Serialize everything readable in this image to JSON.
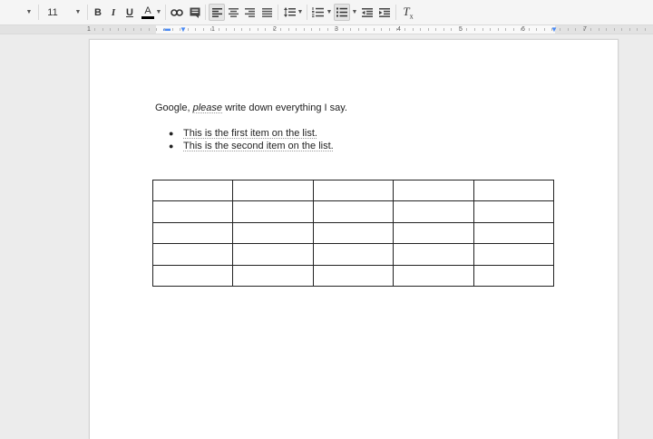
{
  "toolbar": {
    "font_size": "11",
    "bold_label": "B",
    "italic_label": "I",
    "underline_label": "U",
    "text_color_label": "A",
    "clear_format_label": "T",
    "clear_format_sub": "x"
  },
  "ruler": {
    "numbers": [
      "1",
      "1",
      "2",
      "3",
      "4",
      "5",
      "6",
      "7"
    ]
  },
  "document": {
    "paragraph": {
      "pre": "Google, ",
      "italic": "please",
      "post": " write down everything I say."
    },
    "list": [
      "This is the first item on the list.",
      "This is the second item on the list."
    ],
    "table": {
      "rows": 5,
      "cols": 5
    }
  },
  "colors": {
    "text_color_bar": "#000000",
    "ruler_indent": "#4a8af4",
    "spell_underline": "#dd3333"
  },
  "icons": [
    "chevron-down-icon",
    "link-icon",
    "comment-icon",
    "align-left-icon",
    "align-center-icon",
    "align-right-icon",
    "align-justify-icon",
    "line-spacing-icon",
    "numbered-list-icon",
    "bulleted-list-icon",
    "decrease-indent-icon",
    "increase-indent-icon",
    "clear-formatting-icon"
  ]
}
